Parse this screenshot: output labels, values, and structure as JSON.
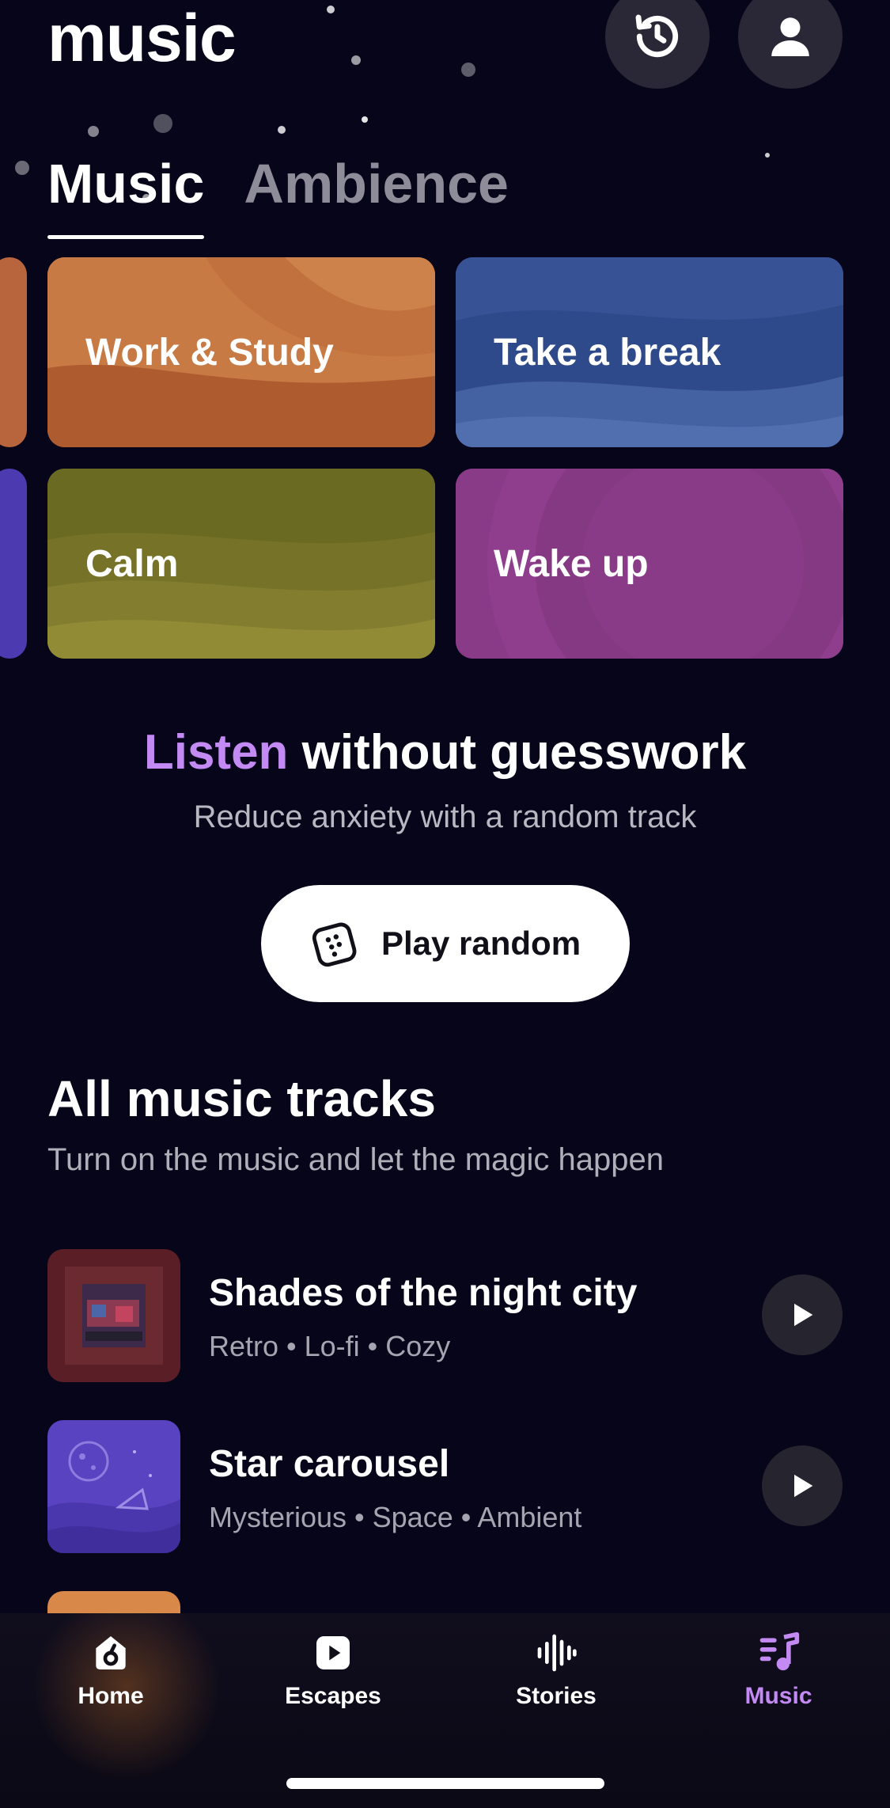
{
  "header": {
    "title": "music",
    "history_icon": "history-icon",
    "profile_icon": "person-icon"
  },
  "tabs": [
    {
      "label": "Music",
      "active": true
    },
    {
      "label": "Ambience",
      "active": false
    }
  ],
  "categories": [
    {
      "label": "Work & Study",
      "color": "#c9763f"
    },
    {
      "label": "Take a break",
      "color": "#3b5597"
    },
    {
      "label": "Calm",
      "color": "#7f7a2e"
    },
    {
      "label": "Wake up",
      "color": "#8a3b88"
    }
  ],
  "promo": {
    "title_accent": "Listen",
    "title_rest": "without guesswork",
    "subtitle": "Reduce anxiety with a random track",
    "button_label": "Play random",
    "button_icon": "dice-icon",
    "accent_color": "#c48af4"
  },
  "tracks_section": {
    "title": "All music tracks",
    "subtitle": "Turn on the music and let the magic happen"
  },
  "tracks": [
    {
      "title": "Shades of the night city",
      "tags": "Retro • Lo-fi • Cozy"
    },
    {
      "title": "Star carousel",
      "tags": "Mysterious • Space • Ambient"
    }
  ],
  "bottom_nav": [
    {
      "label": "Home",
      "icon": "home-icon",
      "active": false
    },
    {
      "label": "Escapes",
      "icon": "play-icon",
      "active": false
    },
    {
      "label": "Stories",
      "icon": "waveform-icon",
      "active": false
    },
    {
      "label": "Music",
      "icon": "music-note-icon",
      "active": true
    }
  ]
}
